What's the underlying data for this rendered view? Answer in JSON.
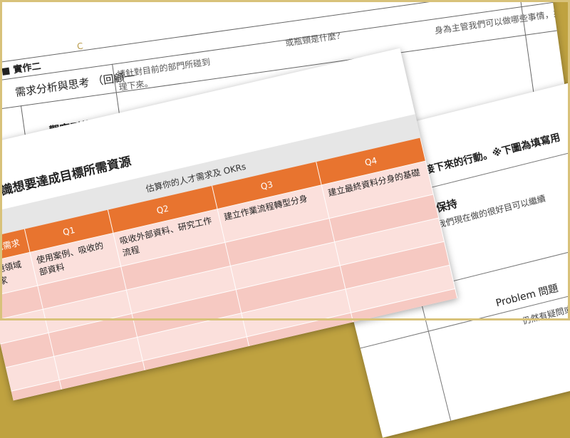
{
  "top_sheet": {
    "logo_fragment": "C",
    "section_label": "■ 實作二",
    "title": "需求分析與思考 （回顧一",
    "instruction": "請針對目前的部門所碰到",
    "instruction_cont": "理下來。",
    "question_fragment": "或瓶頸是什麼？",
    "row_label": "觀察到的現象",
    "manager_fragment": "身為主管我們可以做哪些事情，來"
  },
  "right_sheet": {
    "heading_fragment": "思考接下來的行動。※下圖為填寫用",
    "keep_title": "p 保持",
    "keep_desc": "是我們現在做的很好目可以繼續",
    "problem_title": "Problem 問題",
    "problem_desc": "仍然有疑問或挑戰的"
  },
  "front_sheet": {
    "title": ". 辨識想要達成目標所需資源",
    "table_header": "估算你的人才需求及 OKRs",
    "role_header": "角色需求",
    "quarters": [
      "Q1",
      "Q2",
      "Q3",
      "Q4"
    ],
    "first_row": {
      "role": "主題領域專家",
      "q1": "使用案例、吸收的部資料",
      "q2": "吸收外部資料、研究工作流程",
      "q3": "建立作業流程轉型分身",
      "q4": "建立最終資料分身的基礎"
    }
  }
}
